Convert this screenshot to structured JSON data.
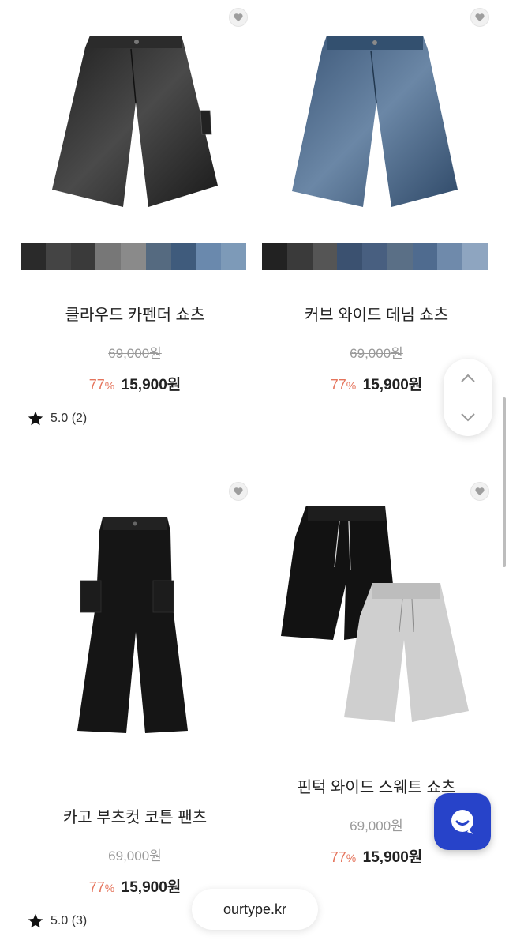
{
  "products": [
    {
      "name": "클라우드 카펜더 쇼츠",
      "original_price": "69,000원",
      "discount_num": "77",
      "discount_unit": "%",
      "sale_price": "15,900원",
      "rating": "5.0 (2)",
      "image_desc": "black-washed-denim-shorts",
      "swatch_colors": [
        "#2a2a2a",
        "#444444",
        "#3a3a3a",
        "#777777",
        "#8a8a8a",
        "#556a80",
        "#3f5b7c",
        "#6a89ad",
        "#7d9ab8"
      ]
    },
    {
      "name": "커브 와이드 데님 쇼츠",
      "original_price": "69,000원",
      "discount_num": "77",
      "discount_unit": "%",
      "sale_price": "15,900원",
      "rating": "",
      "image_desc": "blue-denim-shorts",
      "swatch_colors": [
        "#222222",
        "#3a3a3a",
        "#555555",
        "#3b5170",
        "#485f80",
        "#5a6f86",
        "#4f6b8f",
        "#6f8aab",
        "#8ea5c0"
      ]
    },
    {
      "name": "카고 부츠컷 코튼 팬츠",
      "original_price": "69,000원",
      "discount_num": "77",
      "discount_unit": "%",
      "sale_price": "15,900원",
      "rating": "5.0 (3)",
      "image_desc": "black-cargo-bootcut-pants",
      "swatch_colors": []
    },
    {
      "name": "핀턱 와이드 스웨트 쇼츠",
      "original_price": "69,000원",
      "discount_num": "77",
      "discount_unit": "%",
      "sale_price": "15,900원",
      "rating": "",
      "image_desc": "black-and-gray-sweat-shorts",
      "swatch_colors": []
    }
  ],
  "site_url": "ourtype.kr",
  "colors": {
    "discount": "#e5745c",
    "chat_button": "#2743c9"
  }
}
